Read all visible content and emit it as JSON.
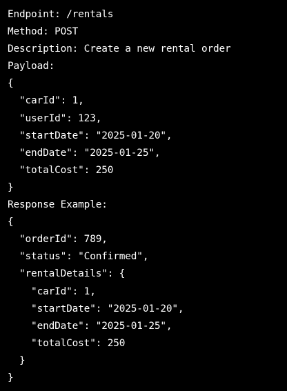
{
  "colors": {
    "background": "#000000",
    "text": "#ffffff"
  },
  "lines": [
    "Endpoint: /rentals",
    "Method: POST",
    "Description: Create a new rental order",
    "Payload:",
    "{",
    "  \"carId\": 1,",
    "  \"userId\": 123,",
    "  \"startDate\": \"2025-01-20\",",
    "  \"endDate\": \"2025-01-25\",",
    "  \"totalCost\": 250",
    "}",
    "Response Example:",
    "{",
    "  \"orderId\": 789,",
    "  \"status\": \"Confirmed\",",
    "  \"rentalDetails\": {",
    "    \"carId\": 1,",
    "    \"startDate\": \"2025-01-20\",",
    "    \"endDate\": \"2025-01-25\",",
    "    \"totalCost\": 250",
    "  }",
    "}"
  ]
}
